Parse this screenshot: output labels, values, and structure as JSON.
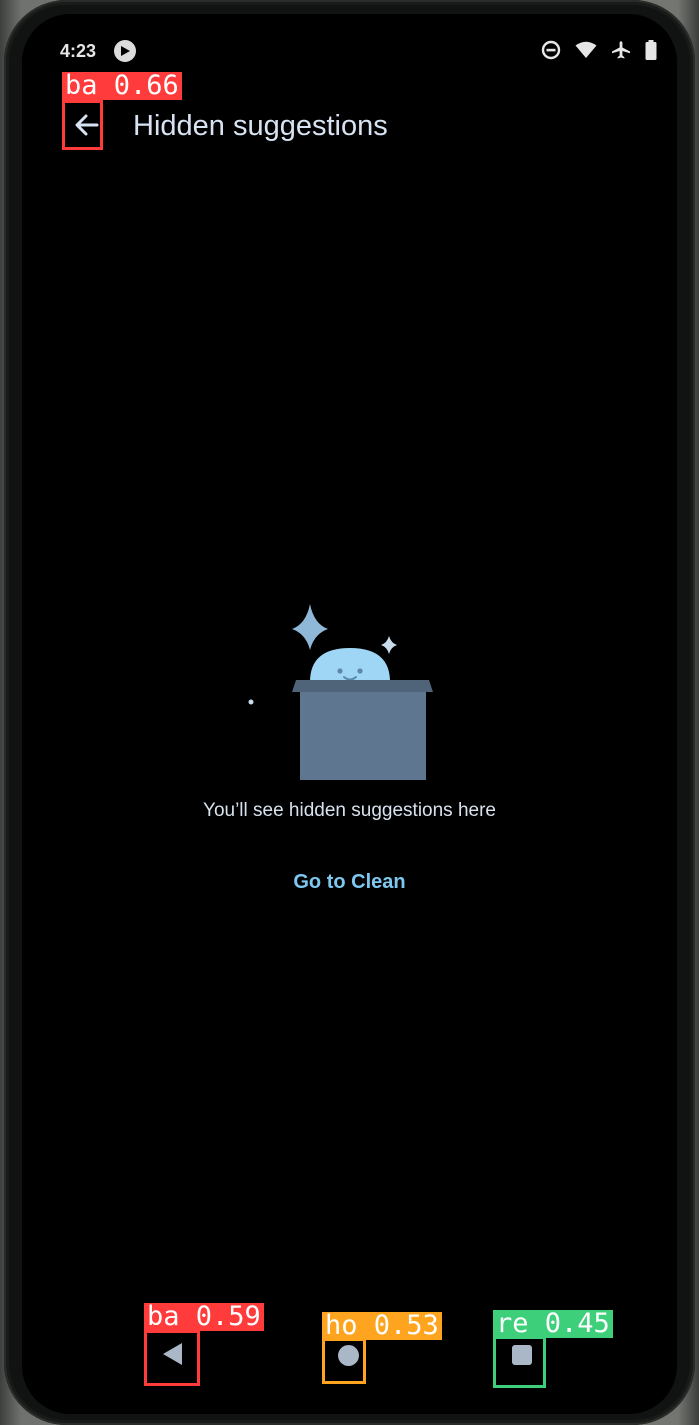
{
  "status_bar": {
    "time": "4:23",
    "icons": [
      "media-notification-icon",
      "dnd-icon",
      "wifi-icon",
      "airplane-mode-icon",
      "battery-icon"
    ]
  },
  "app_bar": {
    "title": "Hidden suggestions",
    "back_icon": "arrow-back-icon"
  },
  "empty_state": {
    "illustration": "box-with-character-illustration",
    "message": "You’ll see hidden suggestions here",
    "action_label": "Go to Clean"
  },
  "navigation_bar": {
    "buttons": [
      "back-triangle-icon",
      "home-circle-icon",
      "recents-square-icon"
    ]
  },
  "detections": [
    {
      "label": "ba 0.66",
      "color": "#ff3b3b"
    },
    {
      "label": "ba 0.59",
      "color": "#ff3b3b"
    },
    {
      "label": "ho 0.53",
      "color": "#ffa41f"
    },
    {
      "label": "re 0.45",
      "color": "#3ecf7a"
    }
  ],
  "colors": {
    "background": "#000000",
    "title_text": "#d7e3f2",
    "accent_link": "#7dc8f0",
    "illustration_box": "#5f7690",
    "illustration_character": "#9fd6f5"
  }
}
